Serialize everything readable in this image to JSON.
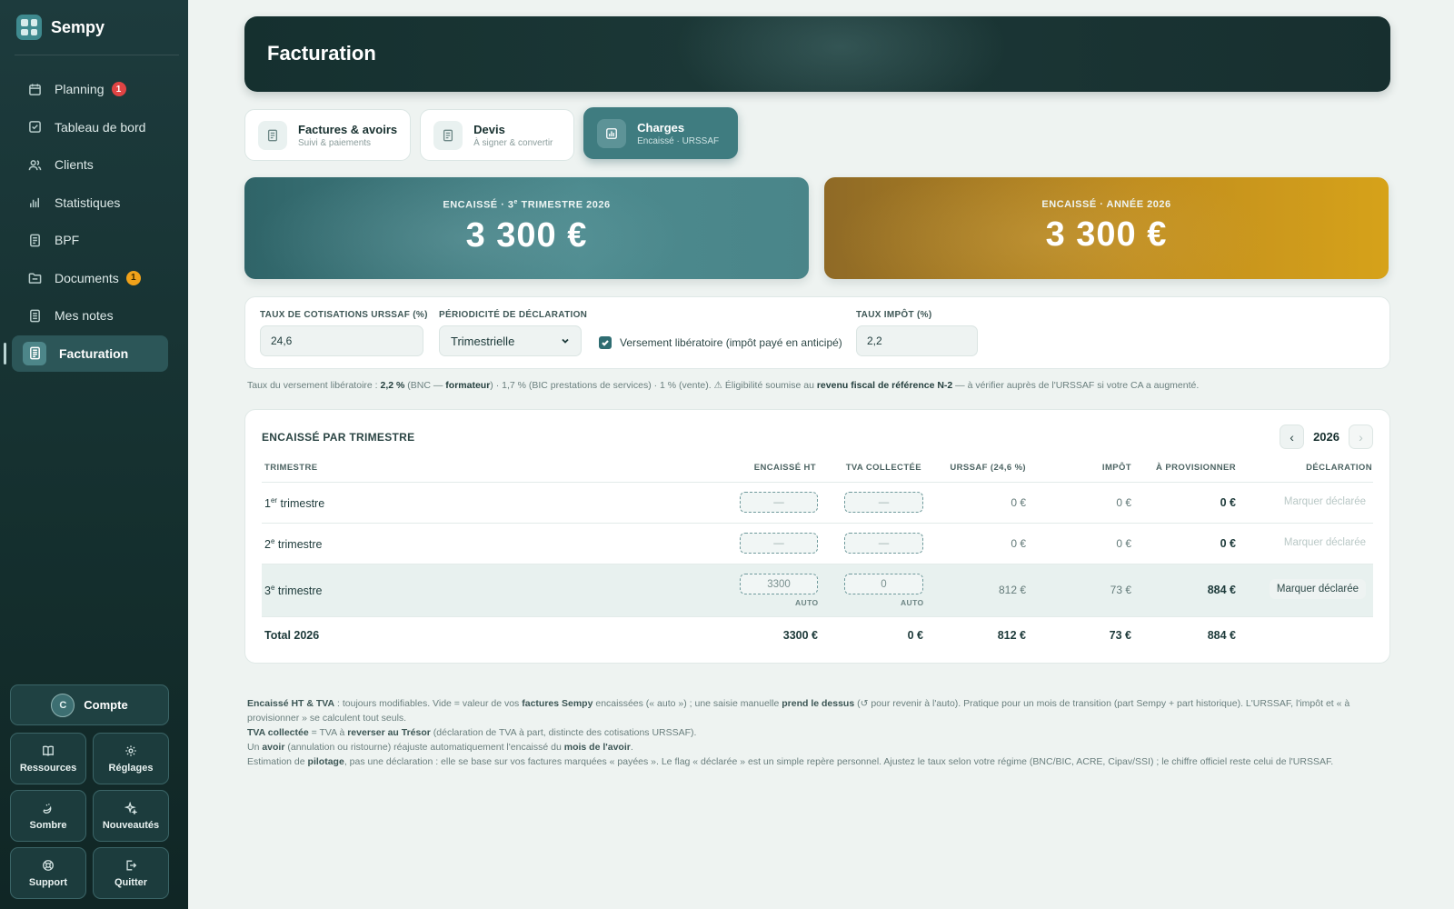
{
  "brand": {
    "name": "Sempy"
  },
  "sidebar": {
    "items": [
      {
        "label": "Planning",
        "icon": "calendar-icon",
        "badge": "1",
        "badge_color": "red"
      },
      {
        "label": "Tableau de bord",
        "icon": "checkbox-icon"
      },
      {
        "label": "Clients",
        "icon": "users-icon"
      },
      {
        "label": "Statistiques",
        "icon": "bar-chart-icon"
      },
      {
        "label": "BPF",
        "icon": "document-icon"
      },
      {
        "label": "Documents",
        "icon": "folder-icon",
        "badge": "1",
        "badge_color": "orange"
      },
      {
        "label": "Mes notes",
        "icon": "notes-icon"
      },
      {
        "label": "Facturation",
        "icon": "invoice-icon",
        "active": true
      }
    ],
    "account": {
      "avatar": "C",
      "label": "Compte"
    },
    "tiles": [
      {
        "label": "Ressources",
        "icon": "book-icon"
      },
      {
        "label": "Réglages",
        "icon": "gear-icon"
      },
      {
        "label": "Sombre",
        "icon": "moon-icon"
      },
      {
        "label": "Nouveautés",
        "icon": "sparkle-icon"
      },
      {
        "label": "Support",
        "icon": "lifebuoy-icon"
      },
      {
        "label": "Quitter",
        "icon": "logout-icon"
      }
    ]
  },
  "header": {
    "title": "Facturation"
  },
  "tabs": [
    {
      "label": "Factures & avoirs",
      "sub": "Suivi & paiements",
      "icon": "document-icon"
    },
    {
      "label": "Devis",
      "sub": "À signer & convertir",
      "icon": "document-icon"
    },
    {
      "label": "Charges",
      "sub": "Encaissé · URSSAF",
      "icon": "bar-chart-icon",
      "active": true
    }
  ],
  "kpis": {
    "quarter": {
      "label_pre": "ENCAISSÉ · 3",
      "label_sup": "e",
      "label_post": " TRIMESTRE 2026",
      "value": "3 300 €"
    },
    "year": {
      "label": "ENCAISSÉ · ANNÉE 2026",
      "value": "3 300 €"
    }
  },
  "settings": {
    "urssaf_label": "TAUX DE COTISATIONS URSSAF (%)",
    "urssaf_value": "24,6",
    "period_label": "PÉRIODICITÉ DE DÉCLARATION",
    "period_value": "Trimestrielle",
    "liberatoire_label": "Versement libératoire (impôt payé en anticipé)",
    "liberatoire_checked": true,
    "impot_label": "TAUX IMPÔT (%)",
    "impot_value": "2,2"
  },
  "rate_note": {
    "p1": "Taux du versement libératoire : ",
    "b1": "2,2 %",
    "p2": " (BNC — ",
    "b2": "formateur",
    "p3": ") · 1,7 % (BIC prestations de services) · 1 % (vente). ⚠ Éligibilité soumise au ",
    "b3": "revenu fiscal de référence N-2",
    "p4": " — à vérifier auprès de l'URSSAF si votre CA a augmenté."
  },
  "table": {
    "title": "ENCAISSÉ PAR TRIMESTRE",
    "year": "2026",
    "columns": [
      "TRIMESTRE",
      "ENCAISSÉ HT",
      "TVA COLLECTÉE",
      "URSSAF (24,6 %)",
      "IMPÔT",
      "À PROVISIONNER",
      "DÉCLARATION"
    ],
    "rows": [
      {
        "num": "1",
        "sup": "er",
        "label": " trimestre",
        "ht": "—",
        "tva": "—",
        "urssaf": "0 €",
        "impot": "0 €",
        "prov": "0 €",
        "decl": "Marquer déclarée"
      },
      {
        "num": "2",
        "sup": "e",
        "label": " trimestre",
        "ht": "—",
        "tva": "—",
        "urssaf": "0 €",
        "impot": "0 €",
        "prov": "0 €",
        "decl": "Marquer déclarée"
      },
      {
        "num": "3",
        "sup": "e",
        "label": " trimestre",
        "ht": "3300",
        "tva": "0",
        "auto": "AUTO",
        "urssaf": "812 €",
        "impot": "73 €",
        "prov": "884 €",
        "decl": "Marquer déclarée"
      }
    ],
    "total": {
      "label": "Total 2026",
      "ht": "3300 €",
      "tva": "0 €",
      "urssaf": "812 €",
      "impot": "73 €",
      "prov": "884 €"
    }
  },
  "footnotes": {
    "l1b1": "Encaissé HT & TVA",
    "l1p1": " : toujours modifiables. Vide = valeur de vos ",
    "l1b2": "factures Sempy",
    "l1p2": " encaissées (« auto ») ; une saisie manuelle ",
    "l1b3": "prend le dessus",
    "l1p3": " (↺ pour revenir à l'auto). Pratique pour un mois de transition (part Sempy + part historique). L'URSSAF, l'impôt et « à provisionner » se calculent tout seuls.",
    "l2b1": "TVA collectée",
    "l2p1": " = TVA à ",
    "l2b2": "reverser au Trésor",
    "l2p2": " (déclaration de TVA à part, distincte des cotisations URSSAF).",
    "l3p1": "Un ",
    "l3b1": "avoir",
    "l3p2": " (annulation ou ristourne) réajuste automatiquement l'encaissé du ",
    "l3b2": "mois de l'avoir",
    "l3p3": ".",
    "l4p1": "Estimation de ",
    "l4b1": "pilotage",
    "l4p2": ", pas une déclaration : elle se base sur vos factures marquées « payées ». Le flag « déclarée » est un simple repère personnel. Ajustez le taux selon votre régime (BNC/BIC, ACRE, Cipav/SSI) ; le chiffre officiel reste celui de l'URSSAF."
  }
}
